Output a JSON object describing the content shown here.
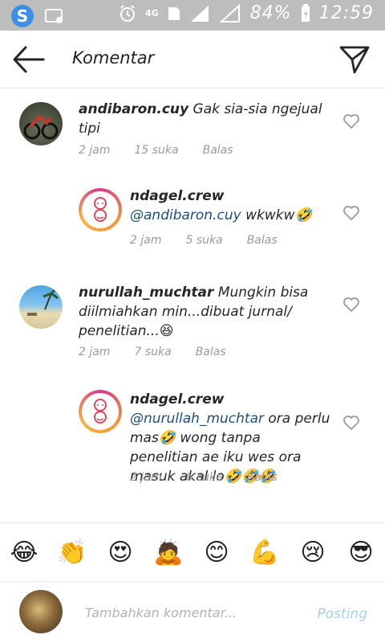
{
  "status_bar": {
    "network": "4G",
    "battery_pct": "84%",
    "time": "12:59"
  },
  "header": {
    "title": "Komentar"
  },
  "comments": [
    {
      "username": "andibaron.cuy",
      "text": "Gak sia-sia ngejual tipi",
      "time": "2 jam",
      "likes": "15 suka",
      "reply": "Balas"
    },
    {
      "username": "ndagel.crew",
      "mention": "@andibaron.cuy",
      "text": "wkwkw🤣",
      "time": "2 jam",
      "likes": "5 suka",
      "reply": "Balas"
    },
    {
      "username": "nurullah_muchtar",
      "text": "Mungkin bisa diilmiahkan min...dibuat jurnal/ penelitian...😆",
      "time": "2 jam",
      "likes": "7 suka",
      "reply": "Balas"
    },
    {
      "username": "ndagel.crew",
      "mention": "@nurullah_muchtar",
      "text": "ora perlu mas🤣 wong tanpa penelitian ae iku wes ora masuk akal lo🤣🤣🤣",
      "time": "2 jam",
      "likes": "6 suka",
      "reply": "Balas"
    }
  ],
  "emoji_bar": [
    "😂",
    "👏",
    "😍",
    "🙇",
    "😊",
    "💪",
    "😢",
    "😎"
  ],
  "composer": {
    "placeholder": "Tambahkan komentar...",
    "post_label": "Posting"
  }
}
